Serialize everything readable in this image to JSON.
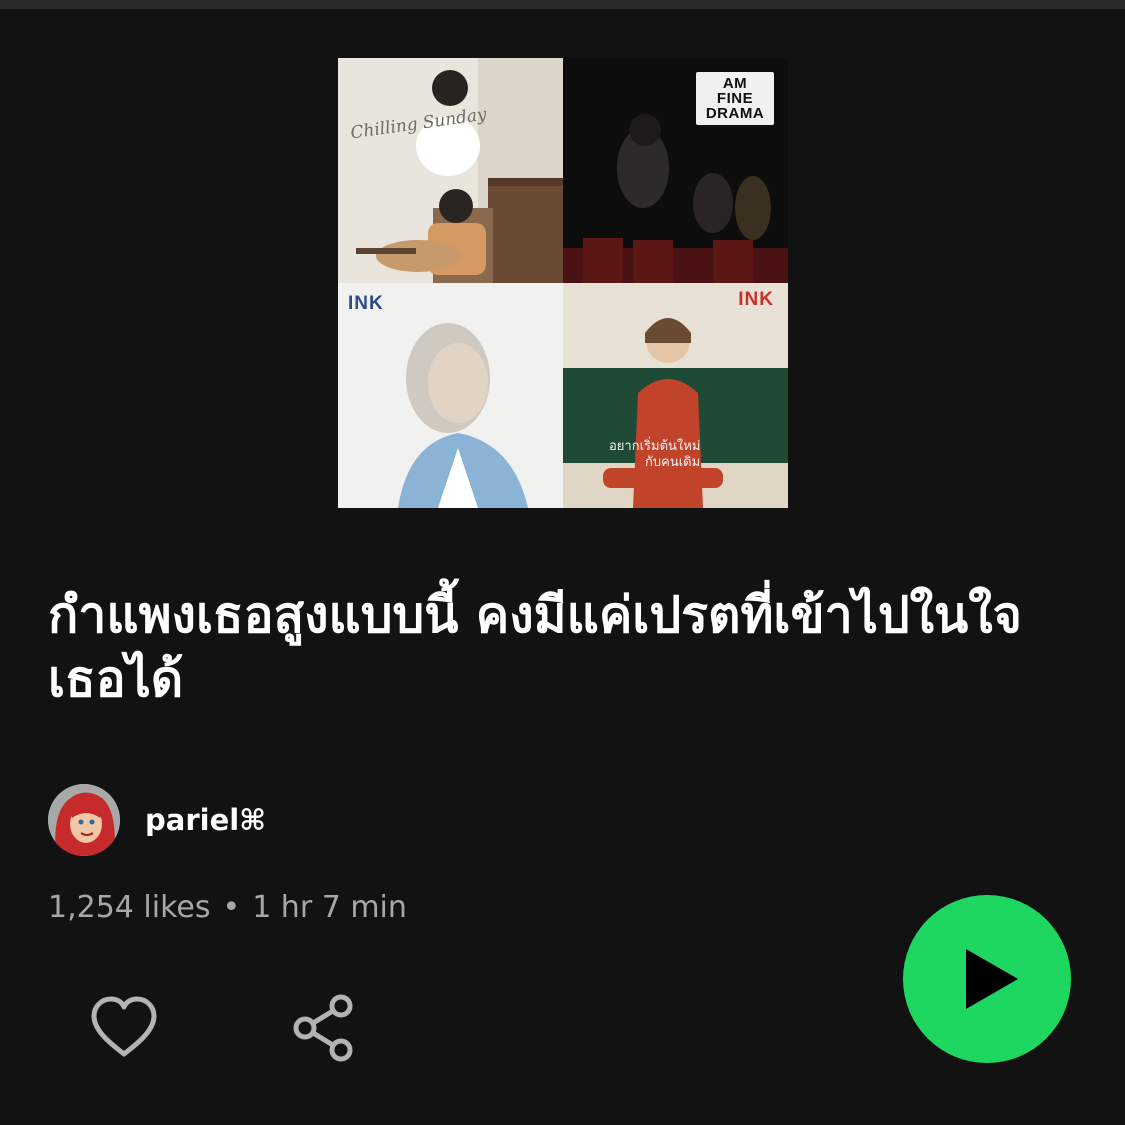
{
  "colors": {
    "background": "#121212",
    "accent": "#1ed760",
    "muted_text": "#a7a7a7"
  },
  "cover": {
    "tiles": [
      {
        "name": "chilling-sunday-cover",
        "text": "Chilling Sunday"
      },
      {
        "name": "am-fine-drama-cover",
        "text_lines": [
          "AM",
          "FINE",
          "DRAMA"
        ]
      },
      {
        "name": "ink-portrait-cover",
        "text": "INK"
      },
      {
        "name": "ink-red-suit-cover",
        "text": "INK",
        "caption_lines": [
          "อยากเริ่มต้นใหม่",
          "กับคนเดิม"
        ]
      }
    ]
  },
  "playlist": {
    "title": "กำแพงเธอสูงแบบนี้ คงมีแค่เปรตที่เข้าไปในใจเธอได้",
    "owner": "pariel⌘",
    "likes": "1,254 likes",
    "separator": "•",
    "duration": "1 hr 7 min"
  },
  "actions": {
    "like_icon": "heart-icon",
    "share_icon": "share-icon",
    "play_icon": "play-icon"
  }
}
